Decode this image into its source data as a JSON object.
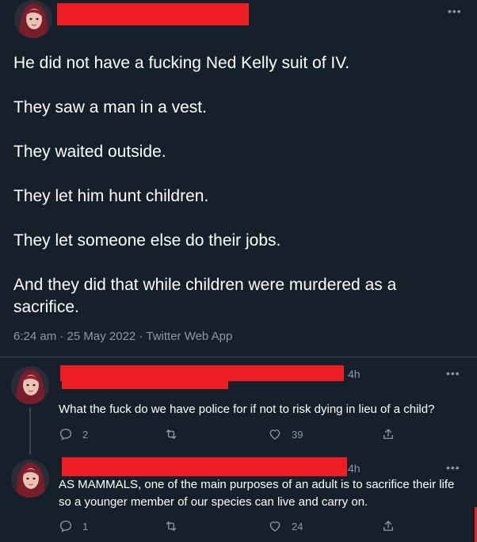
{
  "main_tweet": {
    "text_lines": [
      "He did not have a fucking Ned Kelly suit of IV.",
      "They saw a man in a vest.",
      "They waited outside.",
      "They let him hunt children.",
      "They let someone else do their jobs.",
      "And they did that while children were murdered as a sacrifice."
    ],
    "time": "6:24 am",
    "date": "25 May 2022",
    "source": "Twitter Web App",
    "more_label": "•••"
  },
  "replies": [
    {
      "time": "4h",
      "text": "What the fuck do we have police for if not to risk dying in lieu of a child?",
      "reply_count": "2",
      "retweet_count": "",
      "like_count": "39",
      "more_label": "•••"
    },
    {
      "time": "4h",
      "text": "AS MAMMALS, one of the main purposes of an adult is to sacrifice their life so a younger member of our species can live and carry on.",
      "reply_count": "1",
      "retweet_count": "",
      "like_count": "24",
      "more_label": "•••"
    }
  ],
  "icons": {
    "reply": "reply-icon",
    "retweet": "retweet-icon",
    "like": "heart-icon",
    "share": "share-icon",
    "more": "more-icon"
  },
  "colors": {
    "background": "#15202b",
    "text": "#ffffff",
    "muted": "#8b98a5",
    "divider": "#38444d",
    "redaction": "#ee1d23"
  }
}
